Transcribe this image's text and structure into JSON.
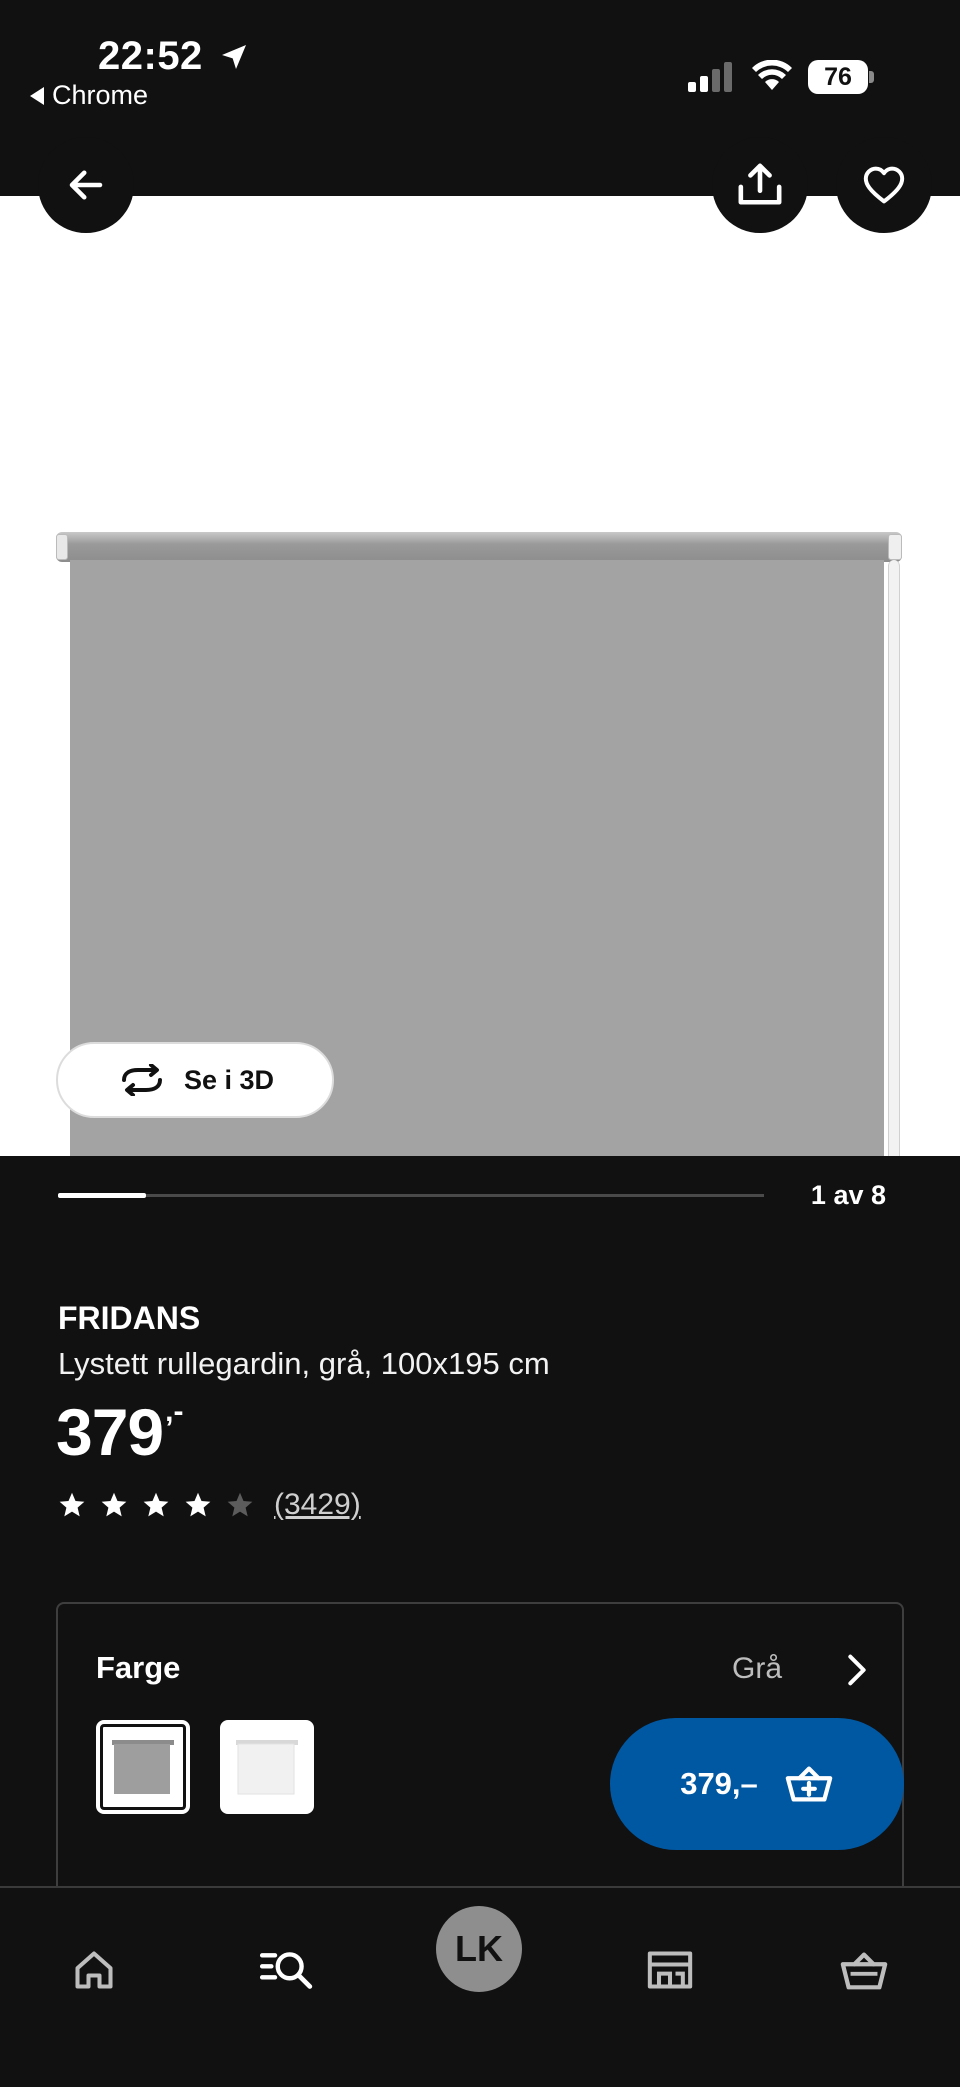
{
  "status_bar": {
    "time": "22:52",
    "back_app": "Chrome",
    "battery": "76"
  },
  "hero": {
    "icons": [
      "arrow-left-icon",
      "share-icon",
      "heart-icon"
    ],
    "view_3d_label": "Se i 3D"
  },
  "gallery": {
    "current": 1,
    "total": 8,
    "label": "1 av 8",
    "progress": 0.125
  },
  "product": {
    "brand": "FRIDANS",
    "description": "Lystett rullegardin, grå, 100x195 cm",
    "price_main": "379",
    "price_suffix": ",-",
    "rating": 4,
    "rating_max": 5,
    "review_count": "(3429)"
  },
  "color": {
    "label": "Farge",
    "value": "Grå",
    "swatches": [
      {
        "name": "Grå",
        "color": "#9e9e9e",
        "selected": true
      },
      {
        "name": "Hvit",
        "color": "#f3f3f3",
        "selected": false
      }
    ]
  },
  "cart_button": {
    "label": "379,–",
    "accent": "#0058a3"
  },
  "bottom_nav": {
    "items": [
      "home-icon",
      "search-list-icon",
      "avatar",
      "store-icon",
      "basket-icon"
    ],
    "avatar_initials": "LK"
  }
}
